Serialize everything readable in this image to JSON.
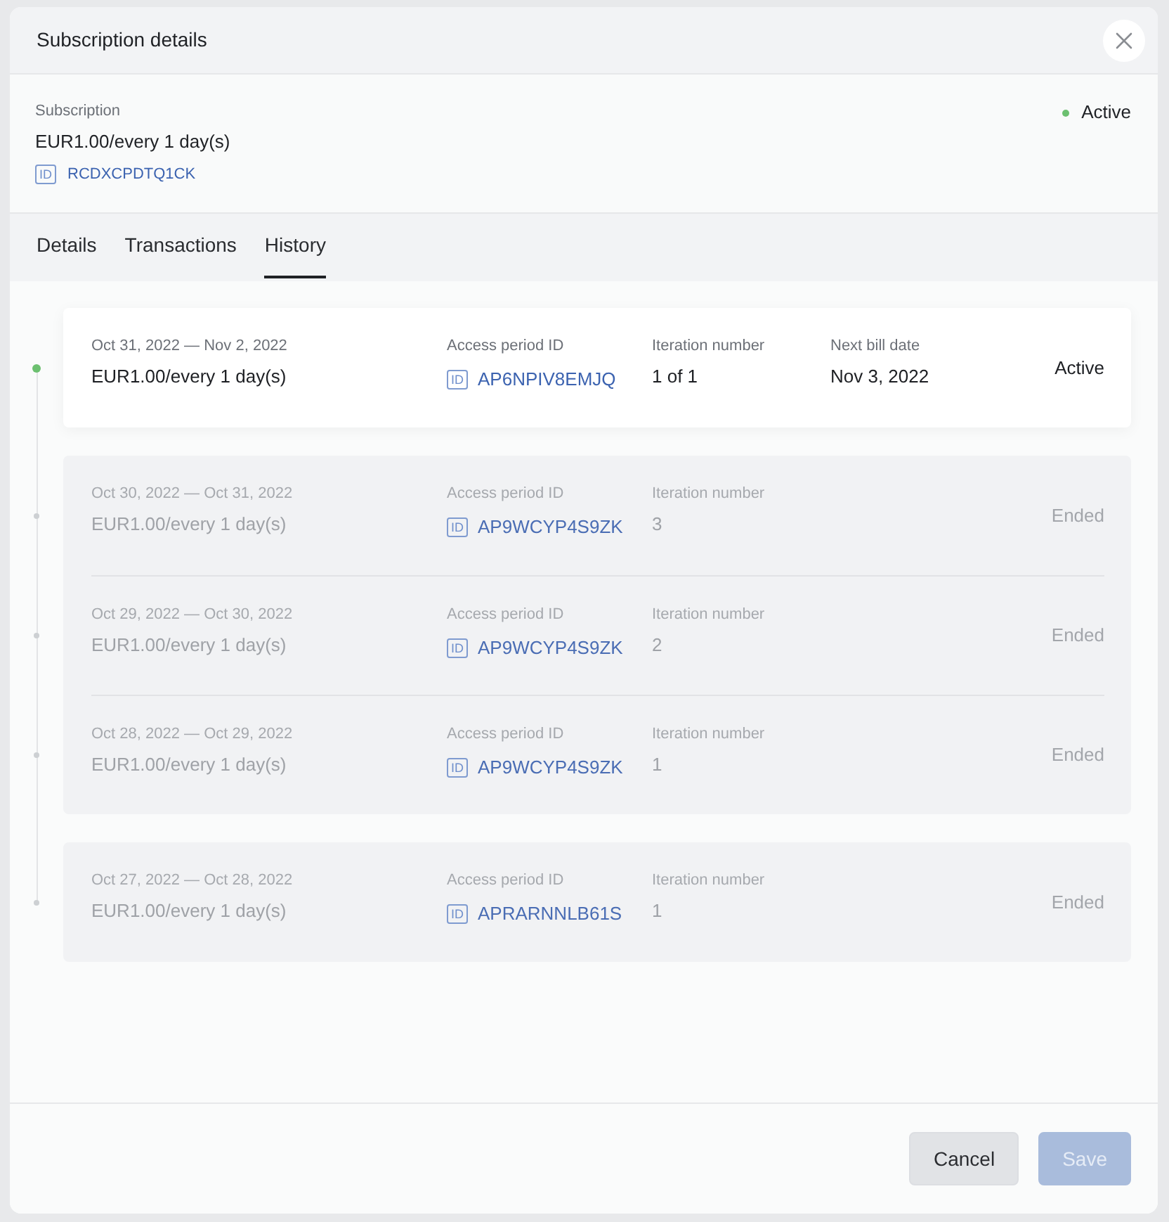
{
  "window": {
    "title": "Subscription details"
  },
  "subscription": {
    "label": "Subscription",
    "price": "EUR1.00/every 1 day(s)",
    "id_tag": "ID",
    "id": "RCDXCPDTQ1CK",
    "status": "Active",
    "active": true
  },
  "tabs": [
    {
      "label": "Details",
      "selected": false
    },
    {
      "label": "Transactions",
      "selected": false
    },
    {
      "label": "History",
      "selected": true
    }
  ],
  "history": [
    {
      "periods": [
        {
          "dates": "Oct 31, 2022 — Nov 2, 2022",
          "price": "EUR1.00/every 1 day(s)",
          "access_label": "Access period ID",
          "id_tag": "ID",
          "access_period_id": "AP6NPIV8EMJQ",
          "iteration_label": "Iteration number",
          "iteration": "1 of 1",
          "next_bill_label": "Next bill date",
          "next_bill_date": "Nov 3, 2022",
          "status": "Active",
          "active": true
        }
      ]
    },
    {
      "periods": [
        {
          "dates": "Oct 30, 2022 — Oct 31, 2022",
          "price": "EUR1.00/every 1 day(s)",
          "access_label": "Access period ID",
          "id_tag": "ID",
          "access_period_id": "AP9WCYP4S9ZK",
          "iteration_label": "Iteration number",
          "iteration": "3",
          "status": "Ended",
          "active": false
        },
        {
          "dates": "Oct 29, 2022 — Oct 30, 2022",
          "price": "EUR1.00/every 1 day(s)",
          "access_label": "Access period ID",
          "id_tag": "ID",
          "access_period_id": "AP9WCYP4S9ZK",
          "iteration_label": "Iteration number",
          "iteration": "2",
          "status": "Ended",
          "active": false
        },
        {
          "dates": "Oct 28, 2022 — Oct 29, 2022",
          "price": "EUR1.00/every 1 day(s)",
          "access_label": "Access period ID",
          "id_tag": "ID",
          "access_period_id": "AP9WCYP4S9ZK",
          "iteration_label": "Iteration number",
          "iteration": "1",
          "status": "Ended",
          "active": false
        }
      ]
    },
    {
      "periods": [
        {
          "dates": "Oct 27, 2022 — Oct 28, 2022",
          "price": "EUR1.00/every 1 day(s)",
          "access_label": "Access period ID",
          "id_tag": "ID",
          "access_period_id": "APRARNNLB61S",
          "iteration_label": "Iteration number",
          "iteration": "1",
          "status": "Ended",
          "active": false
        }
      ]
    }
  ],
  "buttons": [
    {
      "label": "Cancel",
      "kind": "secondary",
      "disabled": false
    },
    {
      "label": "Save",
      "kind": "primary",
      "disabled": true
    }
  ]
}
